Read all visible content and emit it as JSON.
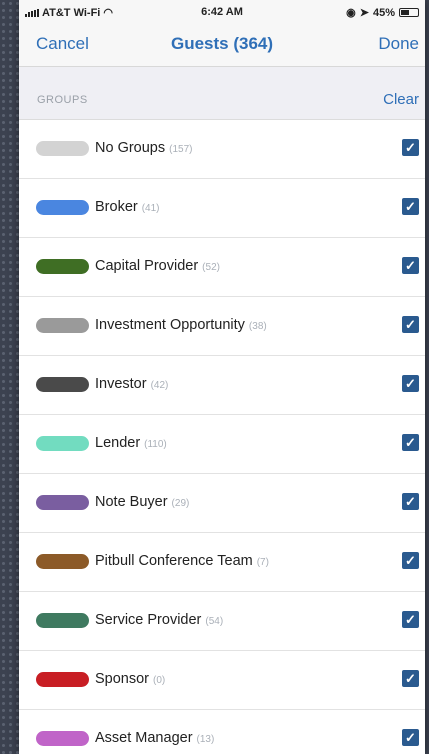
{
  "status_bar": {
    "carrier": "AT&T Wi-Fi",
    "time": "6:42 AM",
    "battery": "45%",
    "battery_level": 0.45
  },
  "nav": {
    "cancel": "Cancel",
    "title": "Guests (364)",
    "done": "Done"
  },
  "section": {
    "title": "GROUPS",
    "clear": "Clear"
  },
  "groups": [
    {
      "name": "No Groups",
      "count": "(157)",
      "color": "#d3d3d3",
      "checked": true
    },
    {
      "name": "Broker",
      "count": "(41)",
      "color": "#4a86e0",
      "checked": true
    },
    {
      "name": "Capital Provider",
      "count": "(52)",
      "color": "#3f6e24",
      "checked": true
    },
    {
      "name": "Investment Opportunity",
      "count": "(38)",
      "color": "#9a9a9a",
      "checked": true
    },
    {
      "name": "Investor",
      "count": "(42)",
      "color": "#4a4a4a",
      "checked": true
    },
    {
      "name": "Lender",
      "count": "(110)",
      "color": "#72dcc0",
      "checked": true
    },
    {
      "name": "Note Buyer",
      "count": "(29)",
      "color": "#7a5ea0",
      "checked": true
    },
    {
      "name": "Pitbull Conference Team",
      "count": "(7)",
      "color": "#8c5a28",
      "checked": true
    },
    {
      "name": "Service Provider",
      "count": "(54)",
      "color": "#3f7a60",
      "checked": true
    },
    {
      "name": "Sponsor",
      "count": "(0)",
      "color": "#c81e24",
      "checked": true
    },
    {
      "name": "Asset Manager",
      "count": "(13)",
      "color": "#c064c8",
      "checked": true
    }
  ],
  "check_glyph": "✓"
}
